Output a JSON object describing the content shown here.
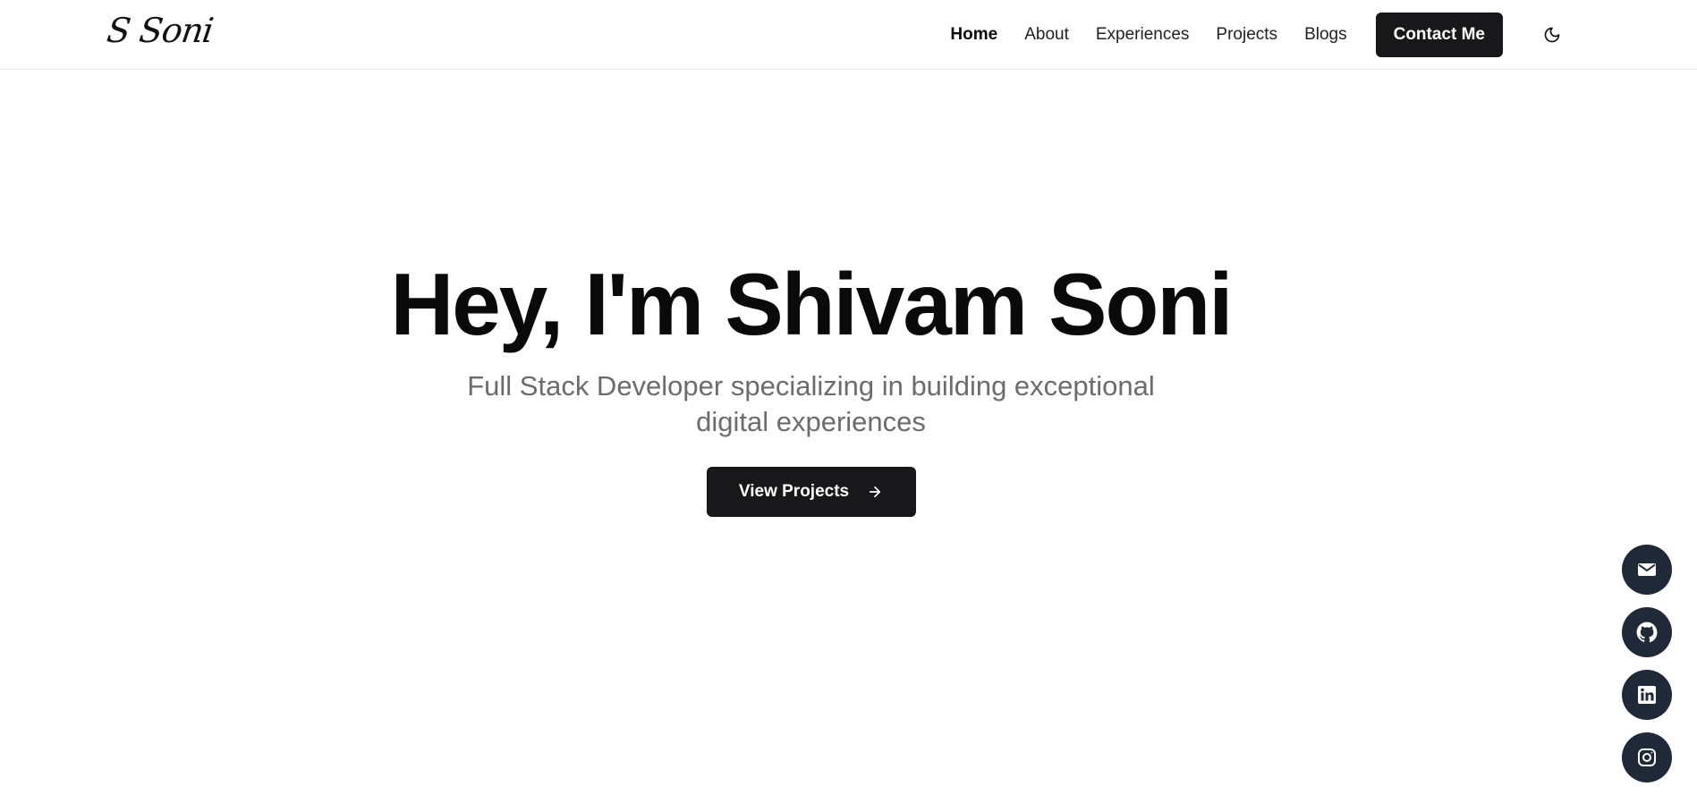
{
  "header": {
    "logo": "S Soni",
    "nav": [
      "Home",
      "About",
      "Experiences",
      "Projects",
      "Blogs"
    ],
    "active": "Home",
    "contact_label": "Contact Me",
    "theme_icon": "moon-icon"
  },
  "hero": {
    "title": "Hey, I'm Shivam Soni",
    "subtitle": "Full Stack Developer specializing in building exceptional digital experiences",
    "cta_label": "View Projects",
    "cta_icon": "arrow-right-icon"
  },
  "socials": [
    {
      "icon": "mail-icon"
    },
    {
      "icon": "github-icon"
    },
    {
      "icon": "linkedin-icon"
    },
    {
      "icon": "instagram-icon"
    }
  ],
  "colors": {
    "primary_button": "#18181b",
    "social_bg": "#1f2937",
    "subtitle": "#6b6b70",
    "border": "#e5e7eb"
  }
}
